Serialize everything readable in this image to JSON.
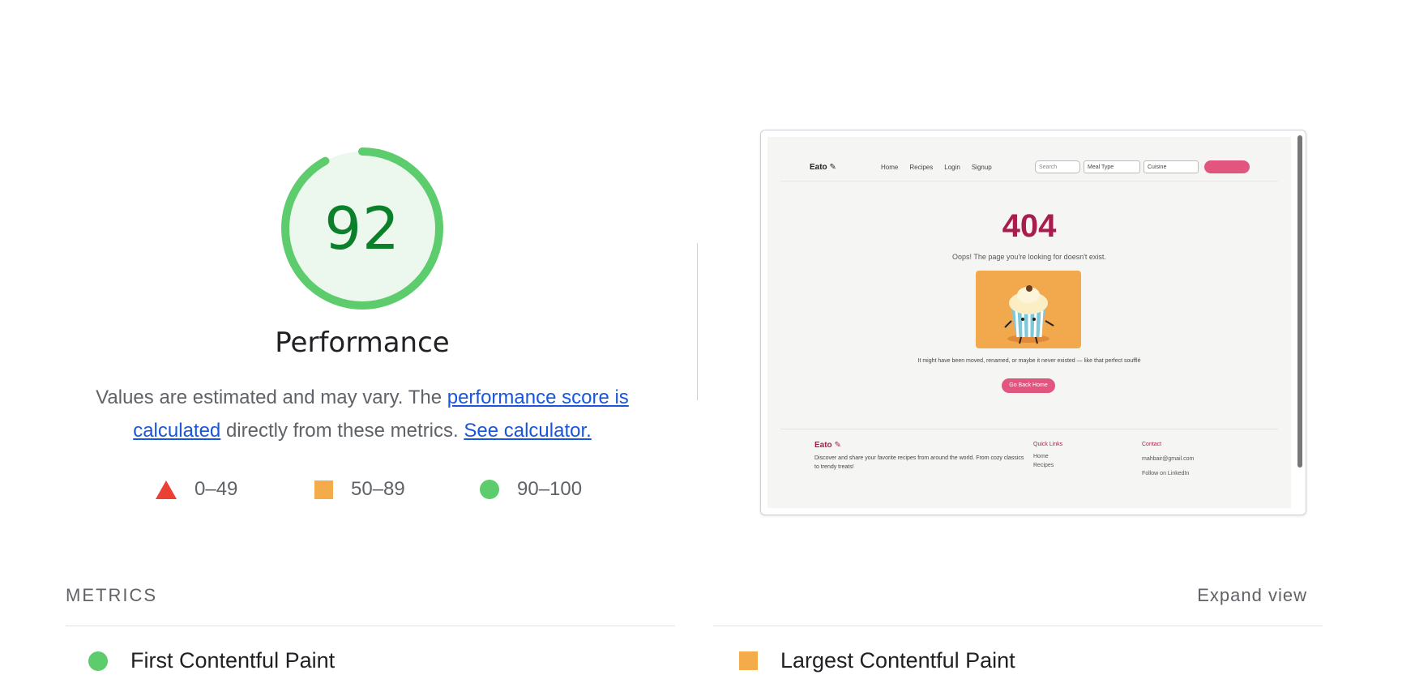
{
  "score": {
    "value": "92",
    "fraction": 0.92,
    "color": "#0b7f2a",
    "ring_color": "#5ccc6c",
    "fill_color": "#ecf8ee",
    "title": "Performance"
  },
  "description": {
    "before": "Values are estimated and may vary. The ",
    "link1": "performance score is calculated",
    "middle": " directly from these metrics. ",
    "link2": "See calculator."
  },
  "legend": [
    {
      "shape": "triangle",
      "color": "#eb4034",
      "label": "0–49"
    },
    {
      "shape": "square",
      "color": "#f4ab49",
      "label": "50–89"
    },
    {
      "shape": "circle",
      "color": "#5ccc6c",
      "label": "90–100"
    }
  ],
  "screenshot": {
    "logo": "Eato",
    "nav": [
      "Home",
      "Recipes",
      "Login",
      "Signup"
    ],
    "search_placeholder": "Search",
    "meal_type": "Meal Type",
    "cuisine": "Cuisine",
    "code": "404",
    "oops": "Oops! The page you're looking for doesn't exist.",
    "message": "It might have been moved, renamed, or maybe it never existed — like that perfect soufflé",
    "home_button": "Go Back Home",
    "footer": {
      "logo": "Eato",
      "desc": "Discover and share your favorite recipes from around the world. From cozy classics to trendy treats!",
      "quick_links_title": "Quick Links",
      "quick_links": [
        "Home",
        "Recipes"
      ],
      "contact_title": "Contact",
      "contact_email": "mahbair@gmail.com",
      "contact_follow": "Follow on LinkedIn"
    }
  },
  "metrics": {
    "section_label": "METRICS",
    "expand_label": "Expand view",
    "items": [
      {
        "label": "First Contentful Paint",
        "status": "circle",
        "color": "#5ccc6c"
      },
      {
        "label": "Largest Contentful Paint",
        "status": "square",
        "color": "#f4ab49"
      }
    ]
  }
}
